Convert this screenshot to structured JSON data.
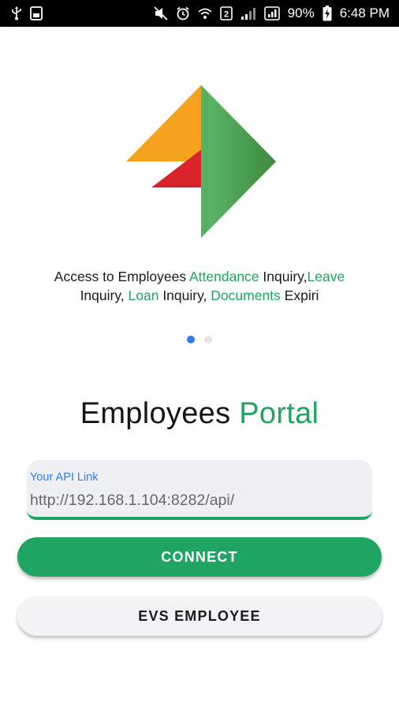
{
  "status_bar": {
    "battery_percent": "90%",
    "time": "6:48 PM",
    "left_icons": [
      "usb-icon",
      "sim-notification-icon"
    ],
    "right_icons": [
      "mute-icon",
      "alarm-icon",
      "wifi-icon",
      "data-icon",
      "signal-icon",
      "battery-charging-icon"
    ]
  },
  "logo": {
    "colors": {
      "orange": "#f5a31e",
      "red": "#d8232a",
      "green": "#1fa463",
      "green_light": "#5cb96a",
      "green_dark": "#3e8a3c"
    }
  },
  "caption": {
    "p1": "Access to Employees ",
    "p2": "Attendance",
    "p3": " Inquiry,",
    "p4": "Leave",
    "p5": " Inquiry, ",
    "p6": "Loan",
    "p7": " Inquiry, ",
    "p8": "Documents",
    "p9": " Expiri"
  },
  "pager": {
    "total": 2,
    "active": 1
  },
  "title": {
    "part1": "Employees ",
    "part2": "Portal"
  },
  "api_field": {
    "label": "Your API Link",
    "value": "http://192.168.1.104:8282/api/"
  },
  "buttons": {
    "connect": "CONNECT",
    "evs_employee": "EVS EMPLOYEE"
  },
  "colors": {
    "accent_green": "#1fa463",
    "accent_blue": "#2f7cf6",
    "field_bg": "#eef0f3",
    "secondary_button_bg": "#f3f3f5"
  }
}
